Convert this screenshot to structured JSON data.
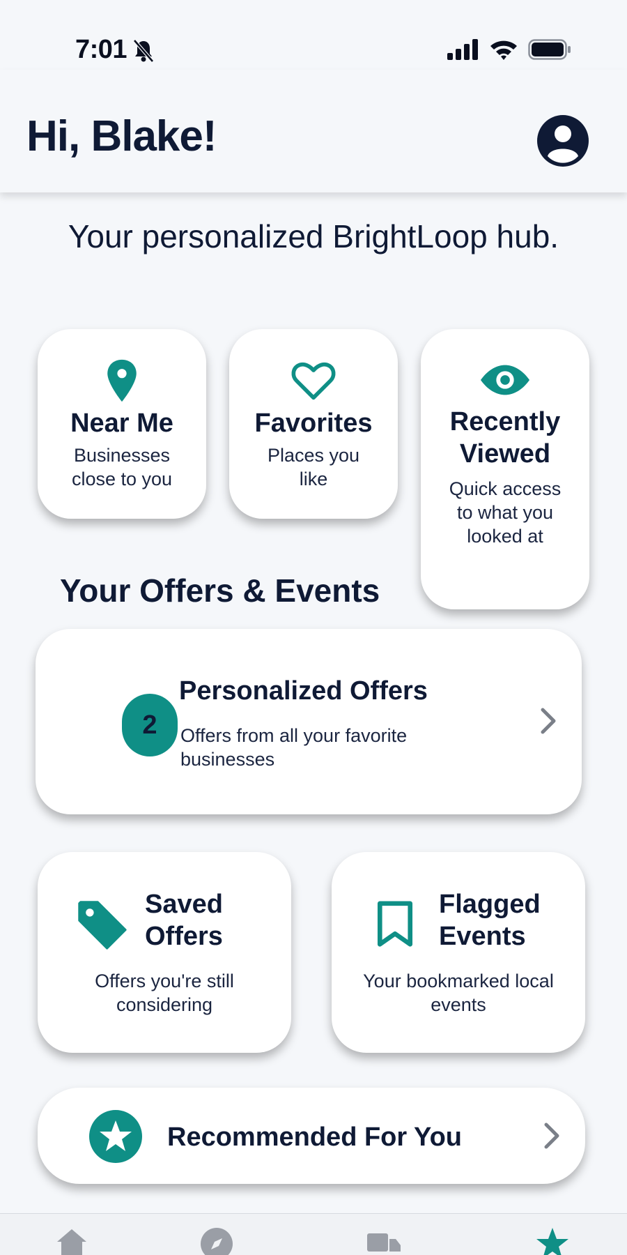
{
  "status_bar": {
    "time": "7:01"
  },
  "header": {
    "greeting": "Hi, Blake!"
  },
  "subtitle": "Your personalized BrightLoop hub.",
  "quick_tiles": [
    {
      "icon": "location-pin-icon",
      "title": "Near Me",
      "desc_line1": "Businesses",
      "desc_line2": "close to you"
    },
    {
      "icon": "heart-icon",
      "title": "Favorites",
      "desc_line1": "Places you",
      "desc_line2": "like"
    },
    {
      "icon": "eye-icon",
      "title_line1": "Recently",
      "title_line2": "Viewed",
      "desc_line1": "Quick access",
      "desc_line2": "to what you",
      "desc_line3": "looked at"
    }
  ],
  "section_title": "Your Offers & Events",
  "personalized_offers": {
    "badge_count": "2",
    "title": "Personalized Offers",
    "desc_line1": "Offers from all your favorite",
    "desc_line2": "businesses"
  },
  "saved_offers": {
    "icon": "tag-icon",
    "title_line1": "Saved",
    "title_line2": "Offers",
    "desc_line1": "Offers you're still",
    "desc_line2": "considering"
  },
  "flagged_events": {
    "icon": "bookmark-icon",
    "title_line1": "Flagged",
    "title_line2": "Events",
    "desc_line1": "Your bookmarked local",
    "desc_line2": "events"
  },
  "recommended": {
    "icon": "star-icon",
    "title": "Recommended For You"
  },
  "tab_bar": {
    "items": [
      "home-icon",
      "compass-icon",
      "truck-icon",
      "star-icon"
    ]
  },
  "colors": {
    "accent": "#0f8f86",
    "text": "#0f1a35",
    "background": "#f5f7fa"
  }
}
